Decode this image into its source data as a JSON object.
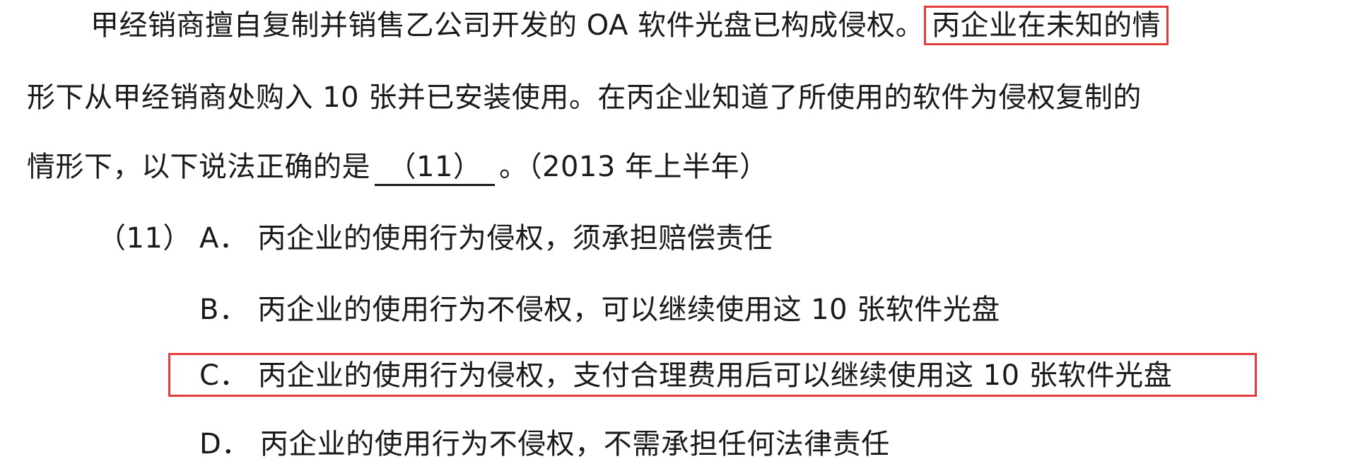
{
  "question": {
    "line1_text": "甲经销商擅自复制并销售乙公司开发的 OA 软件光盘已构成侵权。",
    "line1_highlight": "丙企业在未知的情",
    "line2_text": "形下从甲经销商处购入 10 张并已安装使用。在丙企业知道了所使用的软件为侵权复制的",
    "line3_before": "情形下，以下说法正确的是",
    "blank_label": "（11）",
    "line3_after": "。（2013 年上半年）"
  },
  "options": {
    "number_label": "（11）",
    "a": {
      "letter": "A．",
      "text": "丙企业的使用行为侵权，须承担赔偿责任"
    },
    "b": {
      "letter": "B．",
      "text": "丙企业的使用行为不侵权，可以继续使用这 10 张软件光盘"
    },
    "c": {
      "letter": "C．",
      "text": "丙企业的使用行为侵权，支付合理费用后可以继续使用这 10 张软件光盘"
    },
    "d": {
      "letter": "D．",
      "text": "丙企业的使用行为不侵权，不需承担任何法律责任"
    }
  },
  "colors": {
    "highlight_border": "#e53b3b",
    "text": "#1a1a1a"
  }
}
